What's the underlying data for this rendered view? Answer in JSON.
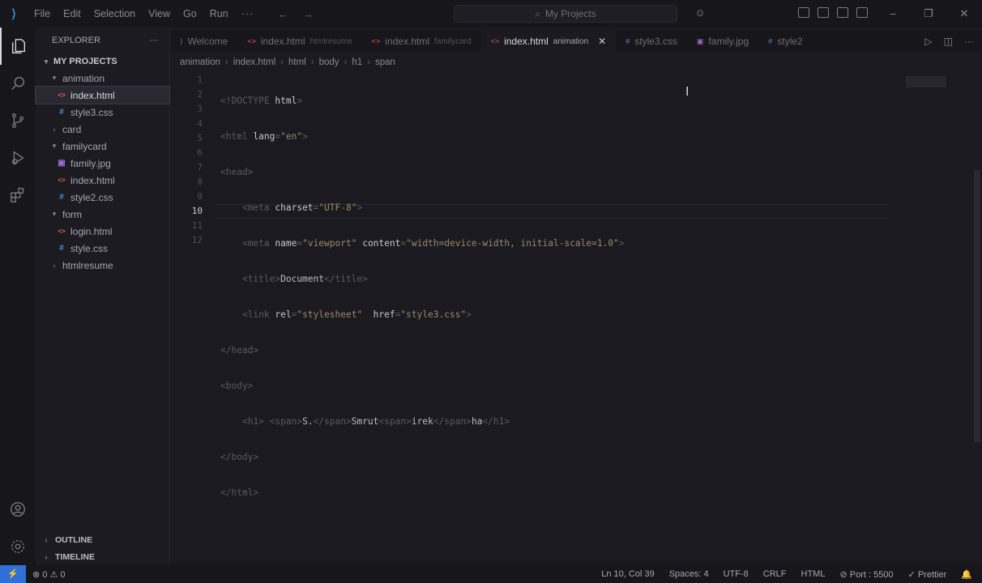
{
  "menu": [
    "File",
    "Edit",
    "Selection",
    "View",
    "Go",
    "Run",
    "···"
  ],
  "command_center": "My Projects",
  "sidebar": {
    "title": "EXPLORER",
    "root": "MY PROJECTS",
    "tree": [
      {
        "label": "animation",
        "type": "folder",
        "open": true,
        "depth": 1
      },
      {
        "label": "index.html",
        "type": "html",
        "depth": 2,
        "selected": true
      },
      {
        "label": "style3.css",
        "type": "css",
        "depth": 2
      },
      {
        "label": "card",
        "type": "folder",
        "open": false,
        "depth": 1
      },
      {
        "label": "familycard",
        "type": "folder",
        "open": true,
        "depth": 1
      },
      {
        "label": "family.jpg",
        "type": "img",
        "depth": 2
      },
      {
        "label": "index.html",
        "type": "html",
        "depth": 2
      },
      {
        "label": "style2.css",
        "type": "css",
        "depth": 2
      },
      {
        "label": "form",
        "type": "folder",
        "open": true,
        "depth": 1
      },
      {
        "label": "login.html",
        "type": "html",
        "depth": 2
      },
      {
        "label": "style.css",
        "type": "css",
        "depth": 2
      },
      {
        "label": "htmlresume",
        "type": "folder",
        "open": false,
        "depth": 1
      }
    ],
    "outline": "OUTLINE",
    "timeline": "TIMELINE"
  },
  "tabs": [
    {
      "label": "Welcome",
      "desc": "",
      "icon": "vscode-icon"
    },
    {
      "label": "index.html",
      "desc": "htmlresume",
      "icon": "html-icon"
    },
    {
      "label": "index.html",
      "desc": "familycard",
      "icon": "html-icon"
    },
    {
      "label": "index.html",
      "desc": "animation",
      "icon": "html-icon",
      "active": true
    },
    {
      "label": "style3.css",
      "desc": "",
      "icon": "css-icon"
    },
    {
      "label": "family.jpg",
      "desc": "",
      "icon": "image-icon"
    },
    {
      "label": "style2",
      "desc": "",
      "icon": "css-icon"
    }
  ],
  "breadcrumb": [
    "animation",
    "index.html",
    "html",
    "body",
    "h1",
    "span"
  ],
  "editor": {
    "line_numbers": [
      "1",
      "2",
      "3",
      "4",
      "5",
      "6",
      "7",
      "8",
      "9",
      "10",
      "11",
      "12"
    ],
    "current_line": "10"
  },
  "status": {
    "remote": "⚡",
    "problems": "⊗ 0 ⚠ 0",
    "cursor": "Ln 10, Col 39",
    "spaces": "Spaces: 4",
    "encoding": "UTF-8",
    "eol": "CRLF",
    "language": "HTML",
    "port": "⊘ Port : 5500",
    "prettier": "✓ Prettier",
    "bell": "🔔"
  }
}
